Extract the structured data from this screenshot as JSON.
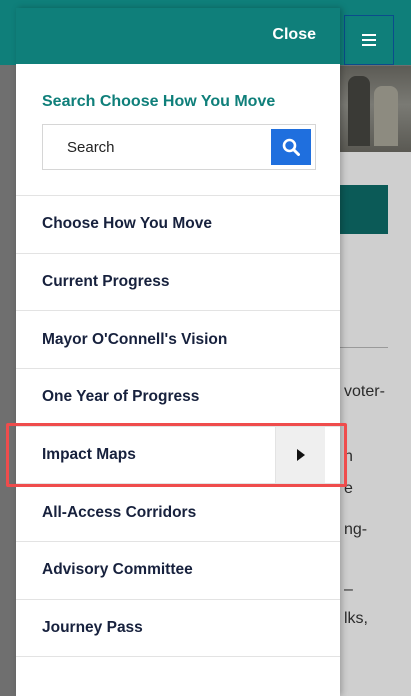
{
  "background": {
    "text_fragments": [
      "voter-",
      "n",
      "e",
      "ng-",
      "–",
      "lks,"
    ]
  },
  "drawer": {
    "close_label": "Close",
    "search_title": "Search Choose How You Move",
    "search_placeholder": "Search",
    "nav_items": [
      {
        "label": "Choose How You Move"
      },
      {
        "label": "Current Progress"
      },
      {
        "label": "Mayor O'Connell's Vision"
      },
      {
        "label": "One Year of Progress"
      },
      {
        "label": "Impact Maps"
      },
      {
        "label": "All-Access Corridors"
      },
      {
        "label": "Advisory Committee"
      },
      {
        "label": "Journey Pass"
      }
    ]
  },
  "icons": {
    "menu": "hamburger-icon",
    "search": "search-icon",
    "expand": "caret-right-icon"
  },
  "colors": {
    "header_teal": "#0f7f7a",
    "search_button": "#1f6fde",
    "nav_text": "#17213d",
    "highlight": "#ef4c4c"
  }
}
